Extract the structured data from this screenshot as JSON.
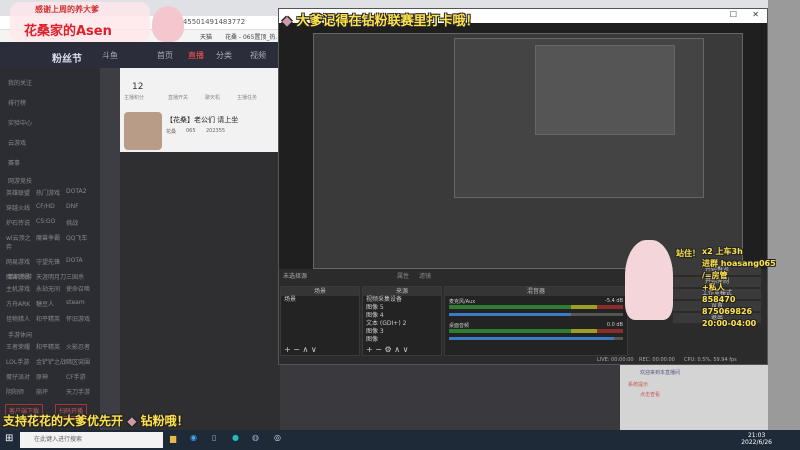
{
  "browser": {
    "url": "175345501491483772",
    "bookmarks": [
      "天猫",
      "花桑 - 065置顶_热..."
    ]
  },
  "douyu": {
    "logo": "粉丝节",
    "brand": "斗鱼",
    "nav": [
      "首页",
      "直播",
      "分类",
      "视频"
    ],
    "stats": {
      "count": "12",
      "labels": [
        "主播积分",
        "直播开关",
        "聊天机",
        "主播任务"
      ]
    },
    "room_title": "【花桑】老公们 请上坐",
    "room_tags": [
      "花桑",
      "065",
      "202355"
    ],
    "sidebar": [
      "我的关注",
      "排行榜",
      "实验中心",
      "云游戏",
      "赛事"
    ],
    "sections": [
      {
        "title": "网游竞技",
        "items": [
          "英雄联盟",
          "热门游戏",
          "DOTA2",
          "穿越火线",
          "CF/HD",
          "DNF",
          "炉石传说",
          "CS:GO",
          "挑战",
          "wl云顶之弈",
          "魔兽争霸",
          "QQ飞车",
          "网易游戏",
          "守望先锋",
          "DOTA",
          "魔兽世界",
          "天涯明月刀",
          "三国杀"
        ]
      },
      {
        "title": "单机热游",
        "items": [
          "主机游戏",
          "永劫无间",
          "使命召唤",
          "方舟ARK",
          "糖豆人",
          "steam",
          "怪物猎人",
          "和平精英",
          "怀旧游戏"
        ]
      },
      {
        "title": "手游休闲",
        "items": [
          "王者荣耀",
          "和平精英",
          "火影忍者",
          "LOL手游",
          "金铲铲之战",
          "暗区突围",
          "蛋仔派对",
          "原神",
          "CF手游",
          "阴阳师",
          "崩坏",
          "天刀手游"
        ]
      }
    ],
    "bottom_buttons": [
      "客户端下载",
      "扫码开播"
    ]
  },
  "overlay": {
    "sticker_top": "感谢上周的养大爹",
    "streamer_name": "花桑家的Asen",
    "title_banner": "大爹记得在钻粉联赛里打卡哦！",
    "bottom_banner": "支持花花的大爹优先开",
    "bottom_banner_tail": "钻粉哦！",
    "greeting": "站住！",
    "lines": [
      "x2 上车3h",
      "进群",
      "hoasang065",
      "/",
      "=房管",
      "+私人",
      "858470",
      "875069826",
      "20:00-04:00"
    ]
  },
  "obs": {
    "scene_label": "未选择源",
    "props": "属性",
    "filters": "滤镜",
    "panels": {
      "scenes": "场景",
      "sources": "来源",
      "mixer": "混音器"
    },
    "scenes": [
      "场景"
    ],
    "sources": [
      "视频采集设备",
      "图像 5",
      "图像 4",
      "文本 (GDI+) 2",
      "图像 3",
      "图像"
    ],
    "mixer": [
      {
        "name": "麦克风/Aux",
        "db": "-5.4 dB",
        "level": 0.7
      },
      {
        "name": "桌面音频",
        "db": "0.0 dB",
        "level": 0.95
      }
    ],
    "controls": [
      "开始推流",
      "开始录制",
      "工作室模式",
      "设置",
      "退出"
    ],
    "status": {
      "live": "LIVE: 00:00:00",
      "rec": "REC: 00:00:00",
      "cpu": "CPU: 0.5%, 59.94 fps"
    }
  },
  "chat": {
    "msg1": "欢迎来到本直播间",
    "msg2": "系统提示",
    "msg3": "点击查看"
  },
  "taskbar": {
    "search_placeholder": "在此键入进行搜索",
    "time": "21:03",
    "date": "2022/6/26"
  }
}
